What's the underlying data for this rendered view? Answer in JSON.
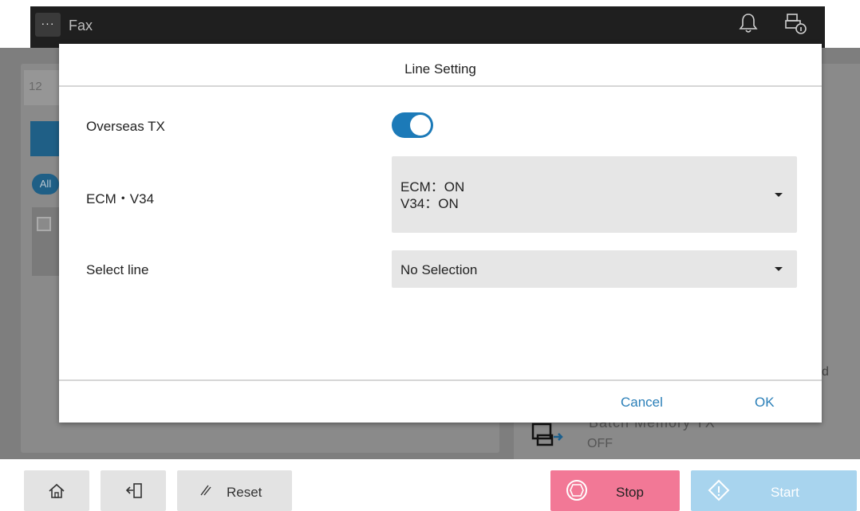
{
  "topbar": {
    "menu_icon": "ellipsis-icon",
    "title": "Fax",
    "bell_icon": "bell-icon",
    "device_icon": "device-info-icon"
  },
  "background": {
    "field_value": "12",
    "all_tab": "All",
    "right_text": "d",
    "memory_label": "Batch Memory TX",
    "memory_value": "OFF"
  },
  "dialog": {
    "title": "Line Setting",
    "overseas_tx": {
      "label": "Overseas TX",
      "state": "on"
    },
    "ecm_v34": {
      "label": "ECM・V34",
      "line1": "ECM：ON",
      "line2": "V34：ON"
    },
    "select_line": {
      "label": "Select line",
      "value": "No Selection"
    },
    "cancel_label": "Cancel",
    "ok_label": "OK"
  },
  "bottombar": {
    "home_icon": "home-icon",
    "logout_icon": "logout-icon",
    "reset_icon": "reset-icon",
    "reset_label": "Reset",
    "stop_icon": "stop-icon",
    "stop_label": "Stop",
    "start_icon": "start-icon",
    "start_label": "Start"
  },
  "colors": {
    "accent": "#1c7ab8",
    "stop": "#f27896",
    "start": "#a8d4ee",
    "topbar": "#1f1f1f"
  }
}
